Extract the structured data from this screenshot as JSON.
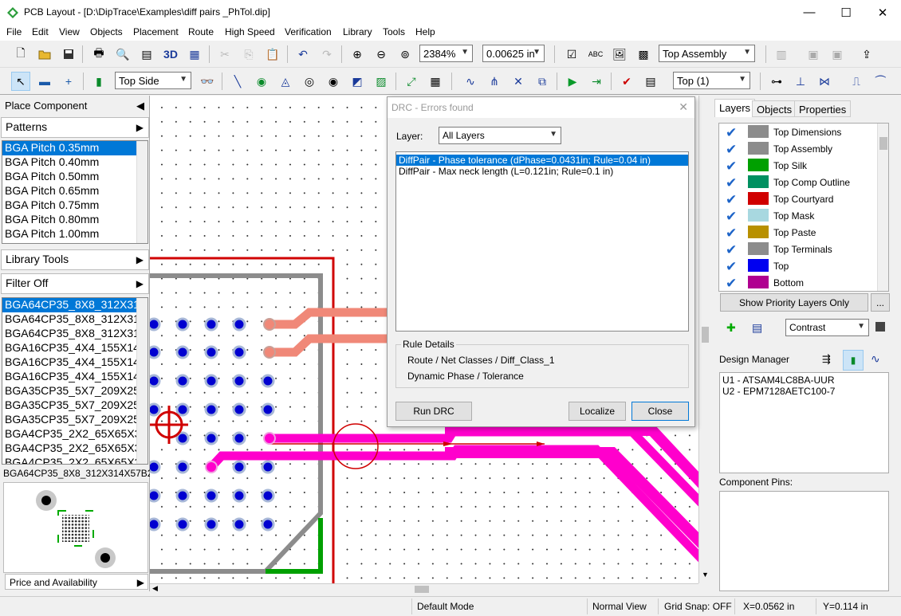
{
  "window": {
    "title": "PCB Layout - [D:\\DipTrace\\Examples\\diff pairs _PhTol.dip]"
  },
  "menu": [
    "File",
    "Edit",
    "View",
    "Objects",
    "Placement",
    "Route",
    "High Speed",
    "Verification",
    "Library",
    "Tools",
    "Help"
  ],
  "toolbar": {
    "zoom": "2384%",
    "grid": "0.00625 in",
    "assembly_layer": "Top Assembly",
    "side": "Top Side",
    "layer": "Top (1)",
    "btn_3d": "3D",
    "btn_abc": "ABC"
  },
  "left_panel": {
    "place_component": "Place Component",
    "patterns": "Patterns",
    "pattern_list": [
      "BGA Pitch 0.35mm",
      "BGA Pitch 0.40mm",
      "BGA Pitch 0.50mm",
      "BGA Pitch 0.65mm",
      "BGA Pitch 0.75mm",
      "BGA Pitch 0.80mm",
      "BGA Pitch 1.00mm"
    ],
    "library_tools": "Library Tools",
    "filter": "Filter Off",
    "components": [
      "BGA64CP35_8X8_312X31",
      "BGA64CP35_8X8_312X31",
      "BGA64CP35_8X8_312X31",
      "BGA16CP35_4X4_155X14",
      "BGA16CP35_4X4_155X14",
      "BGA16CP35_4X4_155X14",
      "BGA35CP35_5X7_209X25",
      "BGA35CP35_5X7_209X25",
      "BGA35CP35_5X7_209X25",
      "BGA4CP35_2X2_65X65X3",
      "BGA4CP35_2X2_65X65X3",
      "BGA4CP35_2X2_65X65X3"
    ],
    "selected_name": "BGA64CP35_8X8_312X314X57B2",
    "price": "Price and Availability"
  },
  "drc": {
    "title": "DRC - Errors found",
    "layer_label": "Layer:",
    "layer_value": "All Layers",
    "errors": [
      "DiffPair - Phase tolerance  (dPhase=0.0431in; Rule=0.04 in)",
      "DiffPair - Max neck length  (L=0.121in; Rule=0.1 in)"
    ],
    "rule_details_label": "Rule Details",
    "rule_lines": [
      "Route / Net Classes / Diff_Class_1",
      "Dynamic Phase / Tolerance"
    ],
    "run_btn": "Run DRC",
    "localize_btn": "Localize",
    "close_btn": "Close"
  },
  "right_panel": {
    "tabs": [
      "Layers",
      "Objects",
      "Properties"
    ],
    "layers": [
      {
        "name": "Top Dimensions",
        "color": "#8c8c8c"
      },
      {
        "name": "Top Assembly",
        "color": "#8c8c8c"
      },
      {
        "name": "Top Silk",
        "color": "#00a000"
      },
      {
        "name": "Top Comp Outline",
        "color": "#009060"
      },
      {
        "name": "Top Courtyard",
        "color": "#d00000"
      },
      {
        "name": "Top Mask",
        "color": "#a8d8e0"
      },
      {
        "name": "Top Paste",
        "color": "#b89000"
      },
      {
        "name": "Top Terminals",
        "color": "#8c8c8c"
      },
      {
        "name": "Top",
        "color": "#0000f0"
      },
      {
        "name": "Bottom",
        "color": "#b00090"
      }
    ],
    "show_priority": "Show Priority Layers Only",
    "more": "...",
    "contrast": "Contrast",
    "design_manager": "Design Manager",
    "parts": [
      "U1 - ATSAM4LC8BA-UUR",
      "U2 - EPM7128AETC100-7"
    ],
    "component_pins": "Component Pins:"
  },
  "status": {
    "mode": "Default Mode",
    "view": "Normal View",
    "grid_snap": "Grid Snap: OFF",
    "x": "X=0.0562 in",
    "y": "Y=0.114 in"
  }
}
